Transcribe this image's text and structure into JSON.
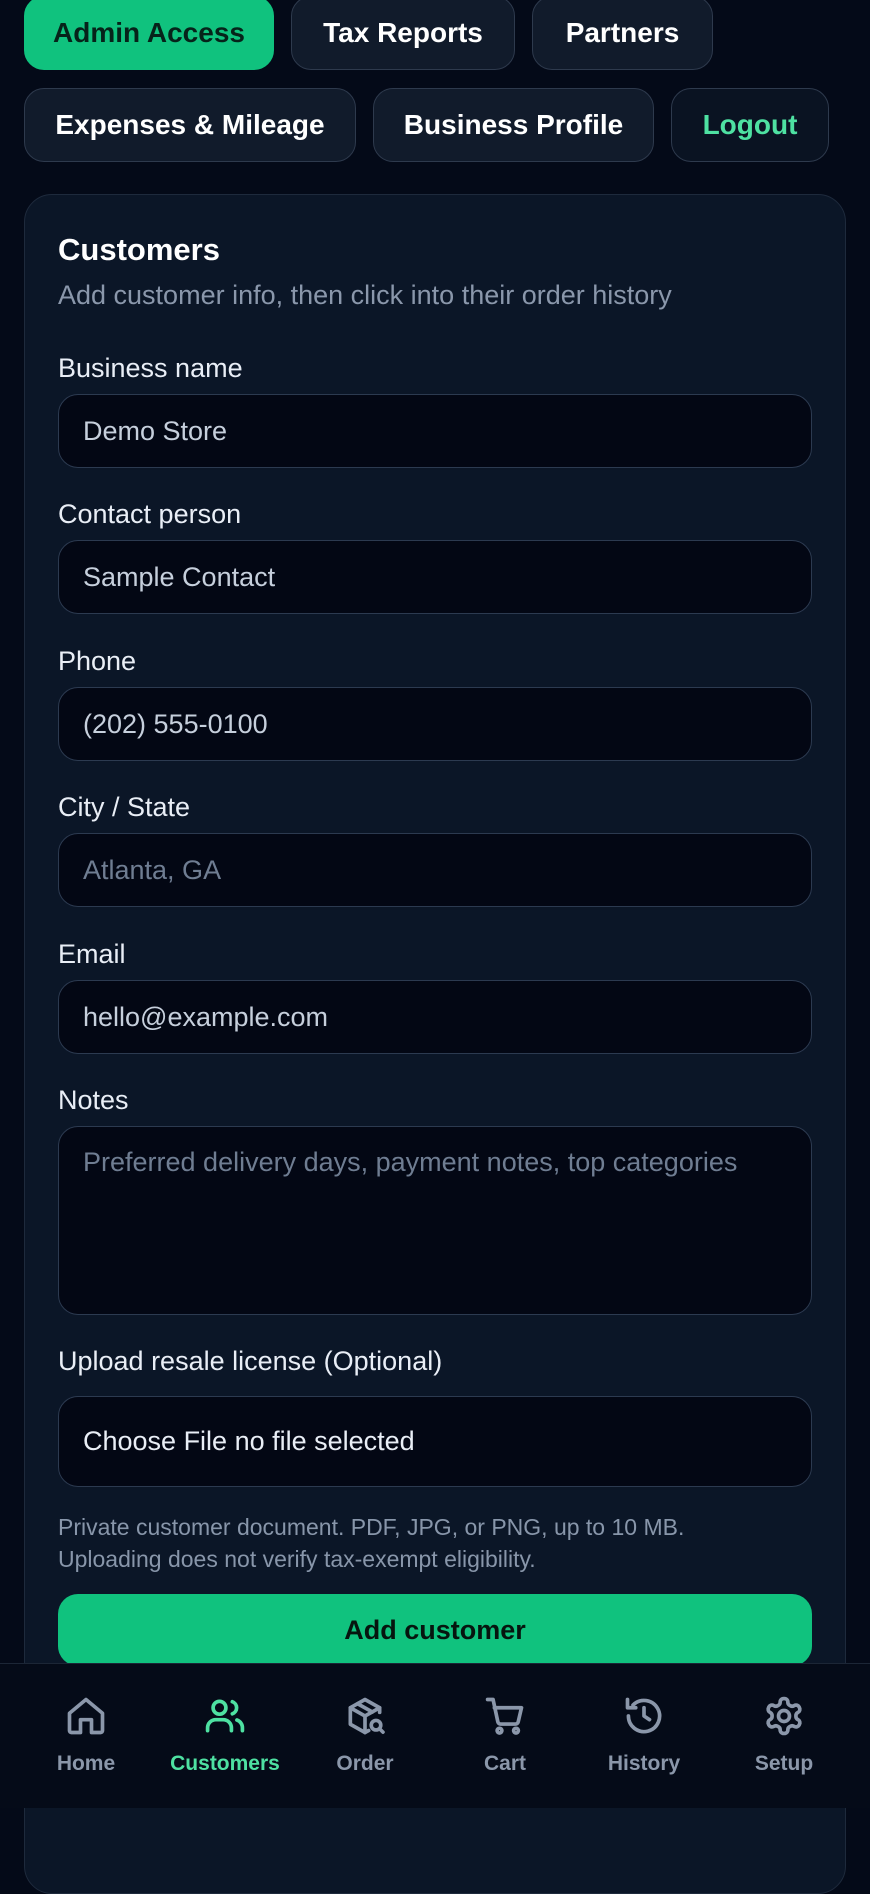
{
  "top_nav": {
    "admin_access": "Admin Access",
    "tax_reports": "Tax Reports",
    "partners": "Partners",
    "expenses_mileage": "Expenses & Mileage",
    "business_profile": "Business Profile",
    "logout": "Logout"
  },
  "customers_form": {
    "title": "Customers",
    "subtitle": "Add customer info, then click into their order history",
    "business_name": {
      "label": "Business name",
      "value": "Demo Store"
    },
    "contact_person": {
      "label": "Contact person",
      "value": "Sample Contact"
    },
    "phone": {
      "label": "Phone",
      "value": "(202) 555-0100"
    },
    "city_state": {
      "label": "City / State",
      "placeholder": "Atlanta, GA"
    },
    "email": {
      "label": "Email",
      "value": "hello@example.com"
    },
    "notes": {
      "label": "Notes",
      "placeholder": "Preferred delivery days, payment notes, top categories"
    },
    "resale_license": {
      "label": "Upload resale license (Optional)",
      "file_text": "Choose File no file selected",
      "hint_line1": "Private customer document. PDF, JPG, or PNG, up to 10 MB.",
      "hint_line2": "Uploading does not verify tax-exempt eligibility."
    },
    "submit_label": "Add customer"
  },
  "bottom_nav": {
    "items": [
      {
        "label": "Home",
        "icon": "home-icon"
      },
      {
        "label": "Customers",
        "icon": "users-icon",
        "active": true
      },
      {
        "label": "Order",
        "icon": "package-search-icon"
      },
      {
        "label": "Cart",
        "icon": "cart-icon"
      },
      {
        "label": "History",
        "icon": "history-icon"
      },
      {
        "label": "Setup",
        "icon": "gear-icon"
      }
    ]
  },
  "colors": {
    "background": "#040a18",
    "card": "#0b1627",
    "accent": "#10c27e",
    "accent_text": "#4ee1a2",
    "muted_text": "#8a97ab"
  }
}
